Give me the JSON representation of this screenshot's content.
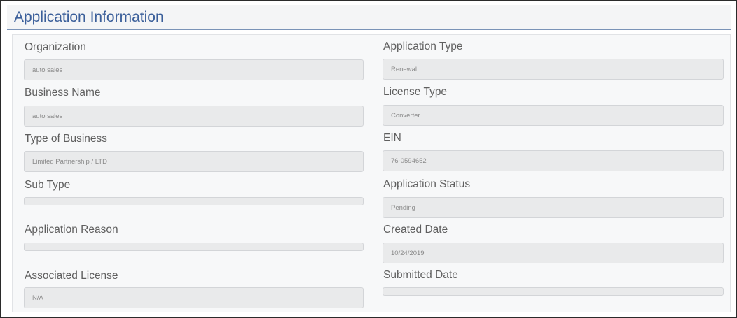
{
  "panel": {
    "title": "Application Information"
  },
  "left_fields": [
    {
      "label": "Organization",
      "value": "auto sales"
    },
    {
      "label": "Business Name",
      "value": "auto sales"
    },
    {
      "label": "Type of Business",
      "value": "Limited Partnership / LTD"
    },
    {
      "label": "Sub Type",
      "value": ""
    },
    {
      "label": "Application Reason",
      "value": ""
    },
    {
      "label": "Associated License",
      "value": "N/A"
    }
  ],
  "right_fields": [
    {
      "label": "Application Type",
      "value": "Renewal"
    },
    {
      "label": "License Type",
      "value": "Converter"
    },
    {
      "label": "EIN",
      "value": "76-0594652"
    },
    {
      "label": "Application Status",
      "value": "Pending"
    },
    {
      "label": "Created Date",
      "value": "10/24/2019"
    },
    {
      "label": "Submitted Date",
      "value": ""
    }
  ],
  "colors": {
    "title_text": "#3b5f9a",
    "title_underline": "#7a93b7",
    "input_background": "#e9eaeb",
    "label_text": "#5f5f5f"
  }
}
